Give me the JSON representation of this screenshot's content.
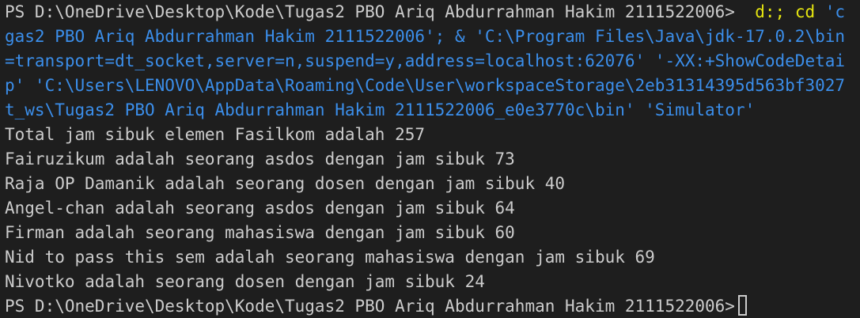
{
  "terminal": {
    "line1": {
      "prompt": "PS D:\\OneDrive\\Desktop\\Kode\\Tugas2 PBO Ariq Abdurrahman Hakim 2111522006>",
      "cmd_part1": "d:; cd",
      "cmd_part2": "'c"
    },
    "wrapped_lines": [
      "gas2 PBO Ariq Abdurrahman Hakim 2111522006'; & 'C:\\Program Files\\Java\\jdk-17.0.2\\bin",
      "=transport=dt_socket,server=n,suspend=y,address=localhost:62076' '-XX:+ShowCodeDetai",
      "p' 'C:\\Users\\LENOVO\\AppData\\Roaming\\Code\\User\\workspaceStorage\\2eb31314395d563bf3027",
      "t_ws\\Tugas2 PBO Ariq Abdurrahman Hakim 2111522006_e0e3770c\\bin' 'Simulator'"
    ],
    "output_lines": [
      "Total jam sibuk elemen Fasilkom adalah 257",
      "Fairuzikum adalah seorang asdos dengan jam sibuk 73",
      "Raja OP Damanik adalah seorang dosen dengan jam sibuk 40",
      "Angel-chan adalah seorang asdos dengan jam sibuk 64",
      "Firman adalah seorang mahasiswa dengan jam sibuk 60",
      "Nid to pass this sem adalah seorang mahasiswa dengan jam sibuk 69",
      "Nivotko adalah seorang dosen dengan jam sibuk 24"
    ],
    "final_prompt": "PS D:\\OneDrive\\Desktop\\Kode\\Tugas2 PBO Ariq Abdurrahman Hakim 2111522006>"
  },
  "colors": {
    "background": "#1e1e1e",
    "text": "#cccccc",
    "command": "#e5e510",
    "string": "#3b8eea"
  }
}
